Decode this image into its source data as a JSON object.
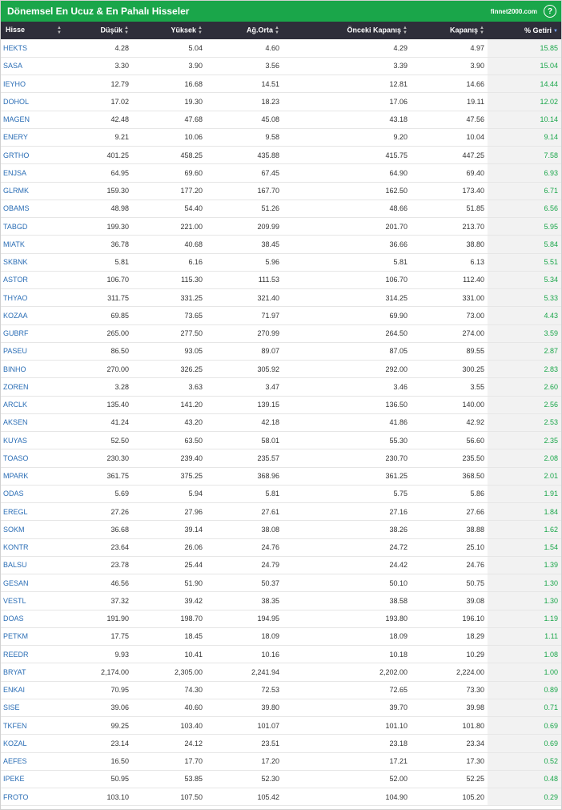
{
  "header": {
    "title": "Dönemsel En Ucuz & En Pahalı Hisseler",
    "site": "finnet2000.com",
    "help": "?"
  },
  "columns": [
    "Hisse",
    "Düşük",
    "Yüksek",
    "Ağ.Orta",
    "Önceki Kapanış",
    "Kapanış",
    "% Getiri"
  ],
  "rows": [
    [
      "HEKTS",
      "4.28",
      "5.04",
      "4.60",
      "4.29",
      "4.97",
      "15.85"
    ],
    [
      "SASA",
      "3.30",
      "3.90",
      "3.56",
      "3.39",
      "3.90",
      "15.04"
    ],
    [
      "IEYHO",
      "12.79",
      "16.68",
      "14.51",
      "12.81",
      "14.66",
      "14.44"
    ],
    [
      "DOHOL",
      "17.02",
      "19.30",
      "18.23",
      "17.06",
      "19.11",
      "12.02"
    ],
    [
      "MAGEN",
      "42.48",
      "47.68",
      "45.08",
      "43.18",
      "47.56",
      "10.14"
    ],
    [
      "ENERY",
      "9.21",
      "10.06",
      "9.58",
      "9.20",
      "10.04",
      "9.14"
    ],
    [
      "GRTHO",
      "401.25",
      "458.25",
      "435.88",
      "415.75",
      "447.25",
      "7.58"
    ],
    [
      "ENJSA",
      "64.95",
      "69.60",
      "67.45",
      "64.90",
      "69.40",
      "6.93"
    ],
    [
      "GLRMK",
      "159.30",
      "177.20",
      "167.70",
      "162.50",
      "173.40",
      "6.71"
    ],
    [
      "OBAMS",
      "48.98",
      "54.40",
      "51.26",
      "48.66",
      "51.85",
      "6.56"
    ],
    [
      "TABGD",
      "199.30",
      "221.00",
      "209.99",
      "201.70",
      "213.70",
      "5.95"
    ],
    [
      "MIATK",
      "36.78",
      "40.68",
      "38.45",
      "36.66",
      "38.80",
      "5.84"
    ],
    [
      "SKBNK",
      "5.81",
      "6.16",
      "5.96",
      "5.81",
      "6.13",
      "5.51"
    ],
    [
      "ASTOR",
      "106.70",
      "115.30",
      "111.53",
      "106.70",
      "112.40",
      "5.34"
    ],
    [
      "THYAO",
      "311.75",
      "331.25",
      "321.40",
      "314.25",
      "331.00",
      "5.33"
    ],
    [
      "KOZAA",
      "69.85",
      "73.65",
      "71.97",
      "69.90",
      "73.00",
      "4.43"
    ],
    [
      "GUBRF",
      "265.00",
      "277.50",
      "270.99",
      "264.50",
      "274.00",
      "3.59"
    ],
    [
      "PASEU",
      "86.50",
      "93.05",
      "89.07",
      "87.05",
      "89.55",
      "2.87"
    ],
    [
      "BINHO",
      "270.00",
      "326.25",
      "305.92",
      "292.00",
      "300.25",
      "2.83"
    ],
    [
      "ZOREN",
      "3.28",
      "3.63",
      "3.47",
      "3.46",
      "3.55",
      "2.60"
    ],
    [
      "ARCLK",
      "135.40",
      "141.20",
      "139.15",
      "136.50",
      "140.00",
      "2.56"
    ],
    [
      "AKSEN",
      "41.24",
      "43.20",
      "42.18",
      "41.86",
      "42.92",
      "2.53"
    ],
    [
      "KUYAS",
      "52.50",
      "63.50",
      "58.01",
      "55.30",
      "56.60",
      "2.35"
    ],
    [
      "TOASO",
      "230.30",
      "239.40",
      "235.57",
      "230.70",
      "235.50",
      "2.08"
    ],
    [
      "MPARK",
      "361.75",
      "375.25",
      "368.96",
      "361.25",
      "368.50",
      "2.01"
    ],
    [
      "ODAS",
      "5.69",
      "5.94",
      "5.81",
      "5.75",
      "5.86",
      "1.91"
    ],
    [
      "EREGL",
      "27.26",
      "27.96",
      "27.61",
      "27.16",
      "27.66",
      "1.84"
    ],
    [
      "SOKM",
      "36.68",
      "39.14",
      "38.08",
      "38.26",
      "38.88",
      "1.62"
    ],
    [
      "KONTR",
      "23.64",
      "26.06",
      "24.76",
      "24.72",
      "25.10",
      "1.54"
    ],
    [
      "BALSU",
      "23.78",
      "25.44",
      "24.79",
      "24.42",
      "24.76",
      "1.39"
    ],
    [
      "GESAN",
      "46.56",
      "51.90",
      "50.37",
      "50.10",
      "50.75",
      "1.30"
    ],
    [
      "VESTL",
      "37.32",
      "39.42",
      "38.35",
      "38.58",
      "39.08",
      "1.30"
    ],
    [
      "DOAS",
      "191.90",
      "198.70",
      "194.95",
      "193.80",
      "196.10",
      "1.19"
    ],
    [
      "PETKM",
      "17.75",
      "18.45",
      "18.09",
      "18.09",
      "18.29",
      "1.11"
    ],
    [
      "REEDR",
      "9.93",
      "10.41",
      "10.16",
      "10.18",
      "10.29",
      "1.08"
    ],
    [
      "BRYAT",
      "2,174.00",
      "2,305.00",
      "2,241.94",
      "2,202.00",
      "2,224.00",
      "1.00"
    ],
    [
      "ENKAI",
      "70.95",
      "74.30",
      "72.53",
      "72.65",
      "73.30",
      "0.89"
    ],
    [
      "SISE",
      "39.06",
      "40.60",
      "39.80",
      "39.70",
      "39.98",
      "0.71"
    ],
    [
      "TKFEN",
      "99.25",
      "103.40",
      "101.07",
      "101.10",
      "101.80",
      "0.69"
    ],
    [
      "KOZAL",
      "23.14",
      "24.12",
      "23.51",
      "23.18",
      "23.34",
      "0.69"
    ],
    [
      "AEFES",
      "16.50",
      "17.70",
      "17.20",
      "17.21",
      "17.30",
      "0.52"
    ],
    [
      "IPEKE",
      "50.95",
      "53.85",
      "52.30",
      "52.00",
      "52.25",
      "0.48"
    ],
    [
      "FROTO",
      "103.10",
      "107.50",
      "105.42",
      "104.90",
      "105.20",
      "0.29"
    ]
  ],
  "colors": {
    "accent": "#1aa64a",
    "header_bg": "#2e2e3a",
    "symbol": "#2a6db5"
  }
}
